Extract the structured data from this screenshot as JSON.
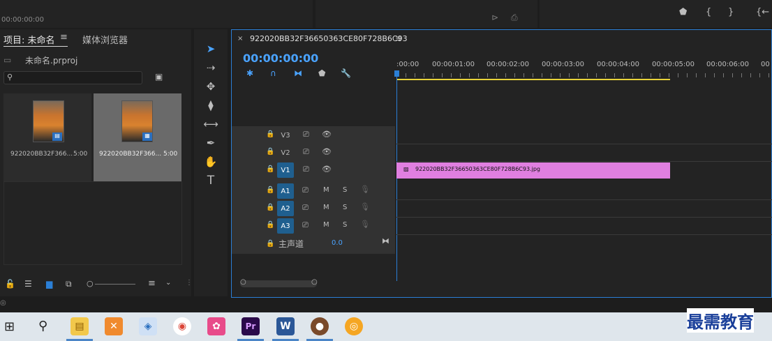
{
  "top": {
    "timecode_small": "00:00:00:00"
  },
  "project_panel": {
    "tab_project": "项目: 未命名",
    "tab_media_browser": "媒体浏览器",
    "project_file": "未命名.prproj",
    "search_placeholder": "",
    "items": [
      {
        "name": "922020BB32F366...",
        "duration": "5:00"
      },
      {
        "name": "922020BB32F366...",
        "duration": "5:00"
      }
    ]
  },
  "timeline": {
    "sequence_name": "922020BB32F36650363CE80F728B6C93",
    "current_timecode": "00:00:00:00",
    "ruler": [
      ":00:00",
      "00:00:01:00",
      "00:00:02:00",
      "00:00:03:00",
      "00:00:04:00",
      "00:00:05:00",
      "00:00:06:00",
      "00"
    ],
    "video_tracks": [
      {
        "label": "V3",
        "active": false
      },
      {
        "label": "V2",
        "active": false
      },
      {
        "label": "V1",
        "active": true
      }
    ],
    "audio_tracks": [
      {
        "label": "A1",
        "m": "M",
        "s": "S"
      },
      {
        "label": "A2",
        "m": "M",
        "s": "S"
      },
      {
        "label": "A3",
        "m": "M",
        "s": "S"
      }
    ],
    "master_label": "主声道",
    "master_value": "0.0",
    "clip_name": "922020BB32F36650363CE80F728B6C93.jpg"
  },
  "watermark": "最需教育",
  "colors": {
    "accent_blue": "#2b7fd6",
    "clip_pink": "#e07fe0",
    "work_area_yellow": "#e8d33a",
    "track_blue": "#1f5f8f"
  }
}
